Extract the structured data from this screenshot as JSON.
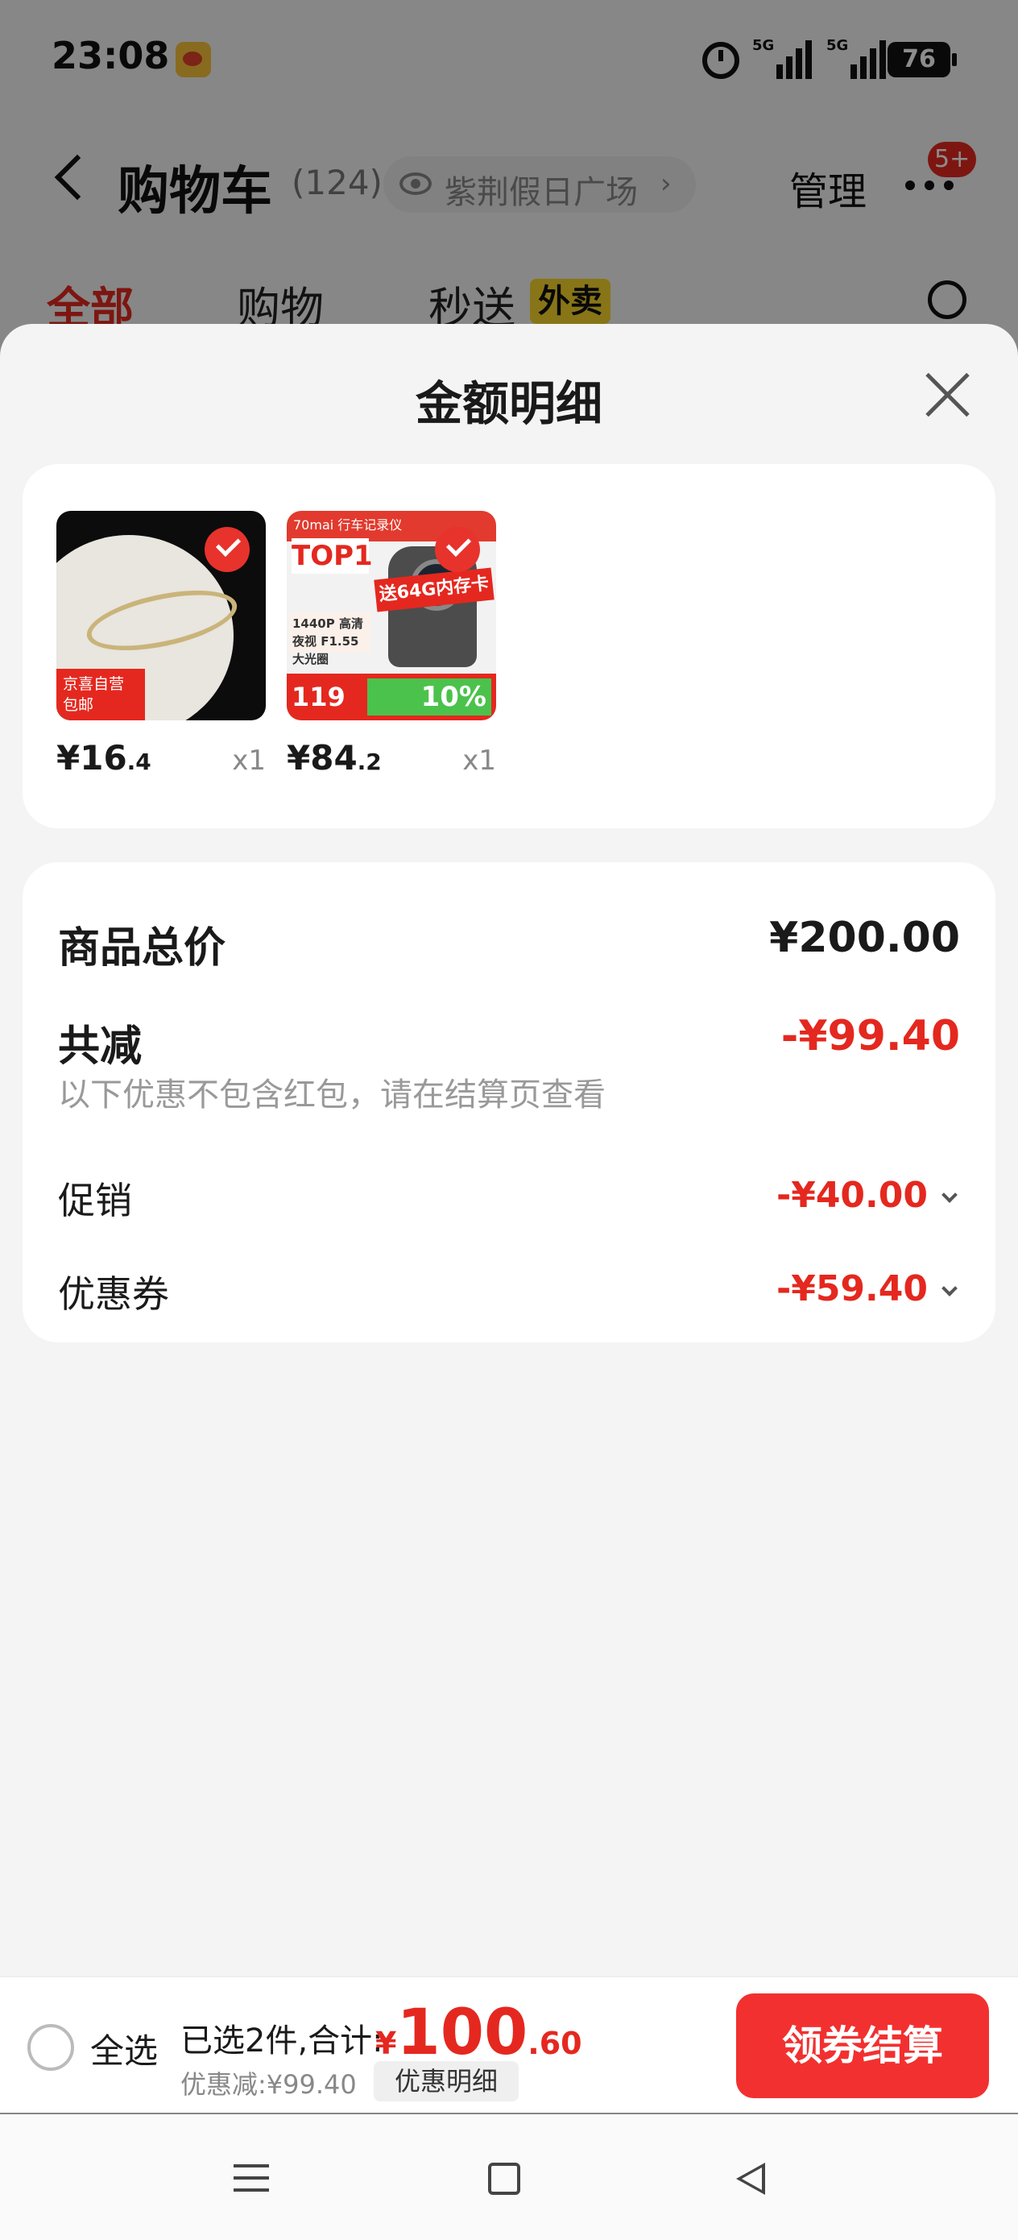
{
  "status_bar": {
    "time": "23:08",
    "battery": "76",
    "network_1": "5G",
    "network_2": "5G"
  },
  "nav": {
    "title": "购物车",
    "count": "(124)",
    "store": "紫荆假日广场",
    "manage": "管理",
    "badge": "5+"
  },
  "tabs": [
    {
      "label": "全部",
      "active": true
    },
    {
      "label": "购物",
      "active": false
    },
    {
      "label": "秒送",
      "active": false
    }
  ],
  "tab_tag": "外卖",
  "sheet": {
    "title": "金额明细"
  },
  "products": [
    {
      "price_int": "¥16",
      "price_dec": ".4",
      "qty": "x1",
      "thumb_tag": "京喜自营\n包邮"
    },
    {
      "price_int": "¥84",
      "price_dec": ".2",
      "qty": "x1",
      "thumb_band": "70mai 行车记录仪",
      "thumb_top1": "TOP1",
      "thumb_promo": "送64G内存卡",
      "thumb_spec": "1440P 高清夜视 F1.55大光圈",
      "thumb_price": "119",
      "thumb_pct": "10%"
    }
  ],
  "summary": {
    "total_label": "商品总价",
    "total_value": "¥200.00",
    "reduce_label": "共减",
    "reduce_value": "-¥99.40",
    "note": "以下优惠不包含红包，请在结算页查看",
    "promo_label": "促销",
    "promo_value": "-¥40.00",
    "coupon_label": "优惠券",
    "coupon_value": "-¥59.40"
  },
  "checkout": {
    "select_all": "全选",
    "summary": "已选2件,合计:",
    "price_symbol": "¥",
    "price_int": "100",
    "price_dec": ".60",
    "discount": "优惠减:¥99.40",
    "detail_btn": "优惠明细",
    "checkout_btn": "领券结算"
  },
  "colors": {
    "accent": "#e4281f",
    "button": "#f23030"
  }
}
